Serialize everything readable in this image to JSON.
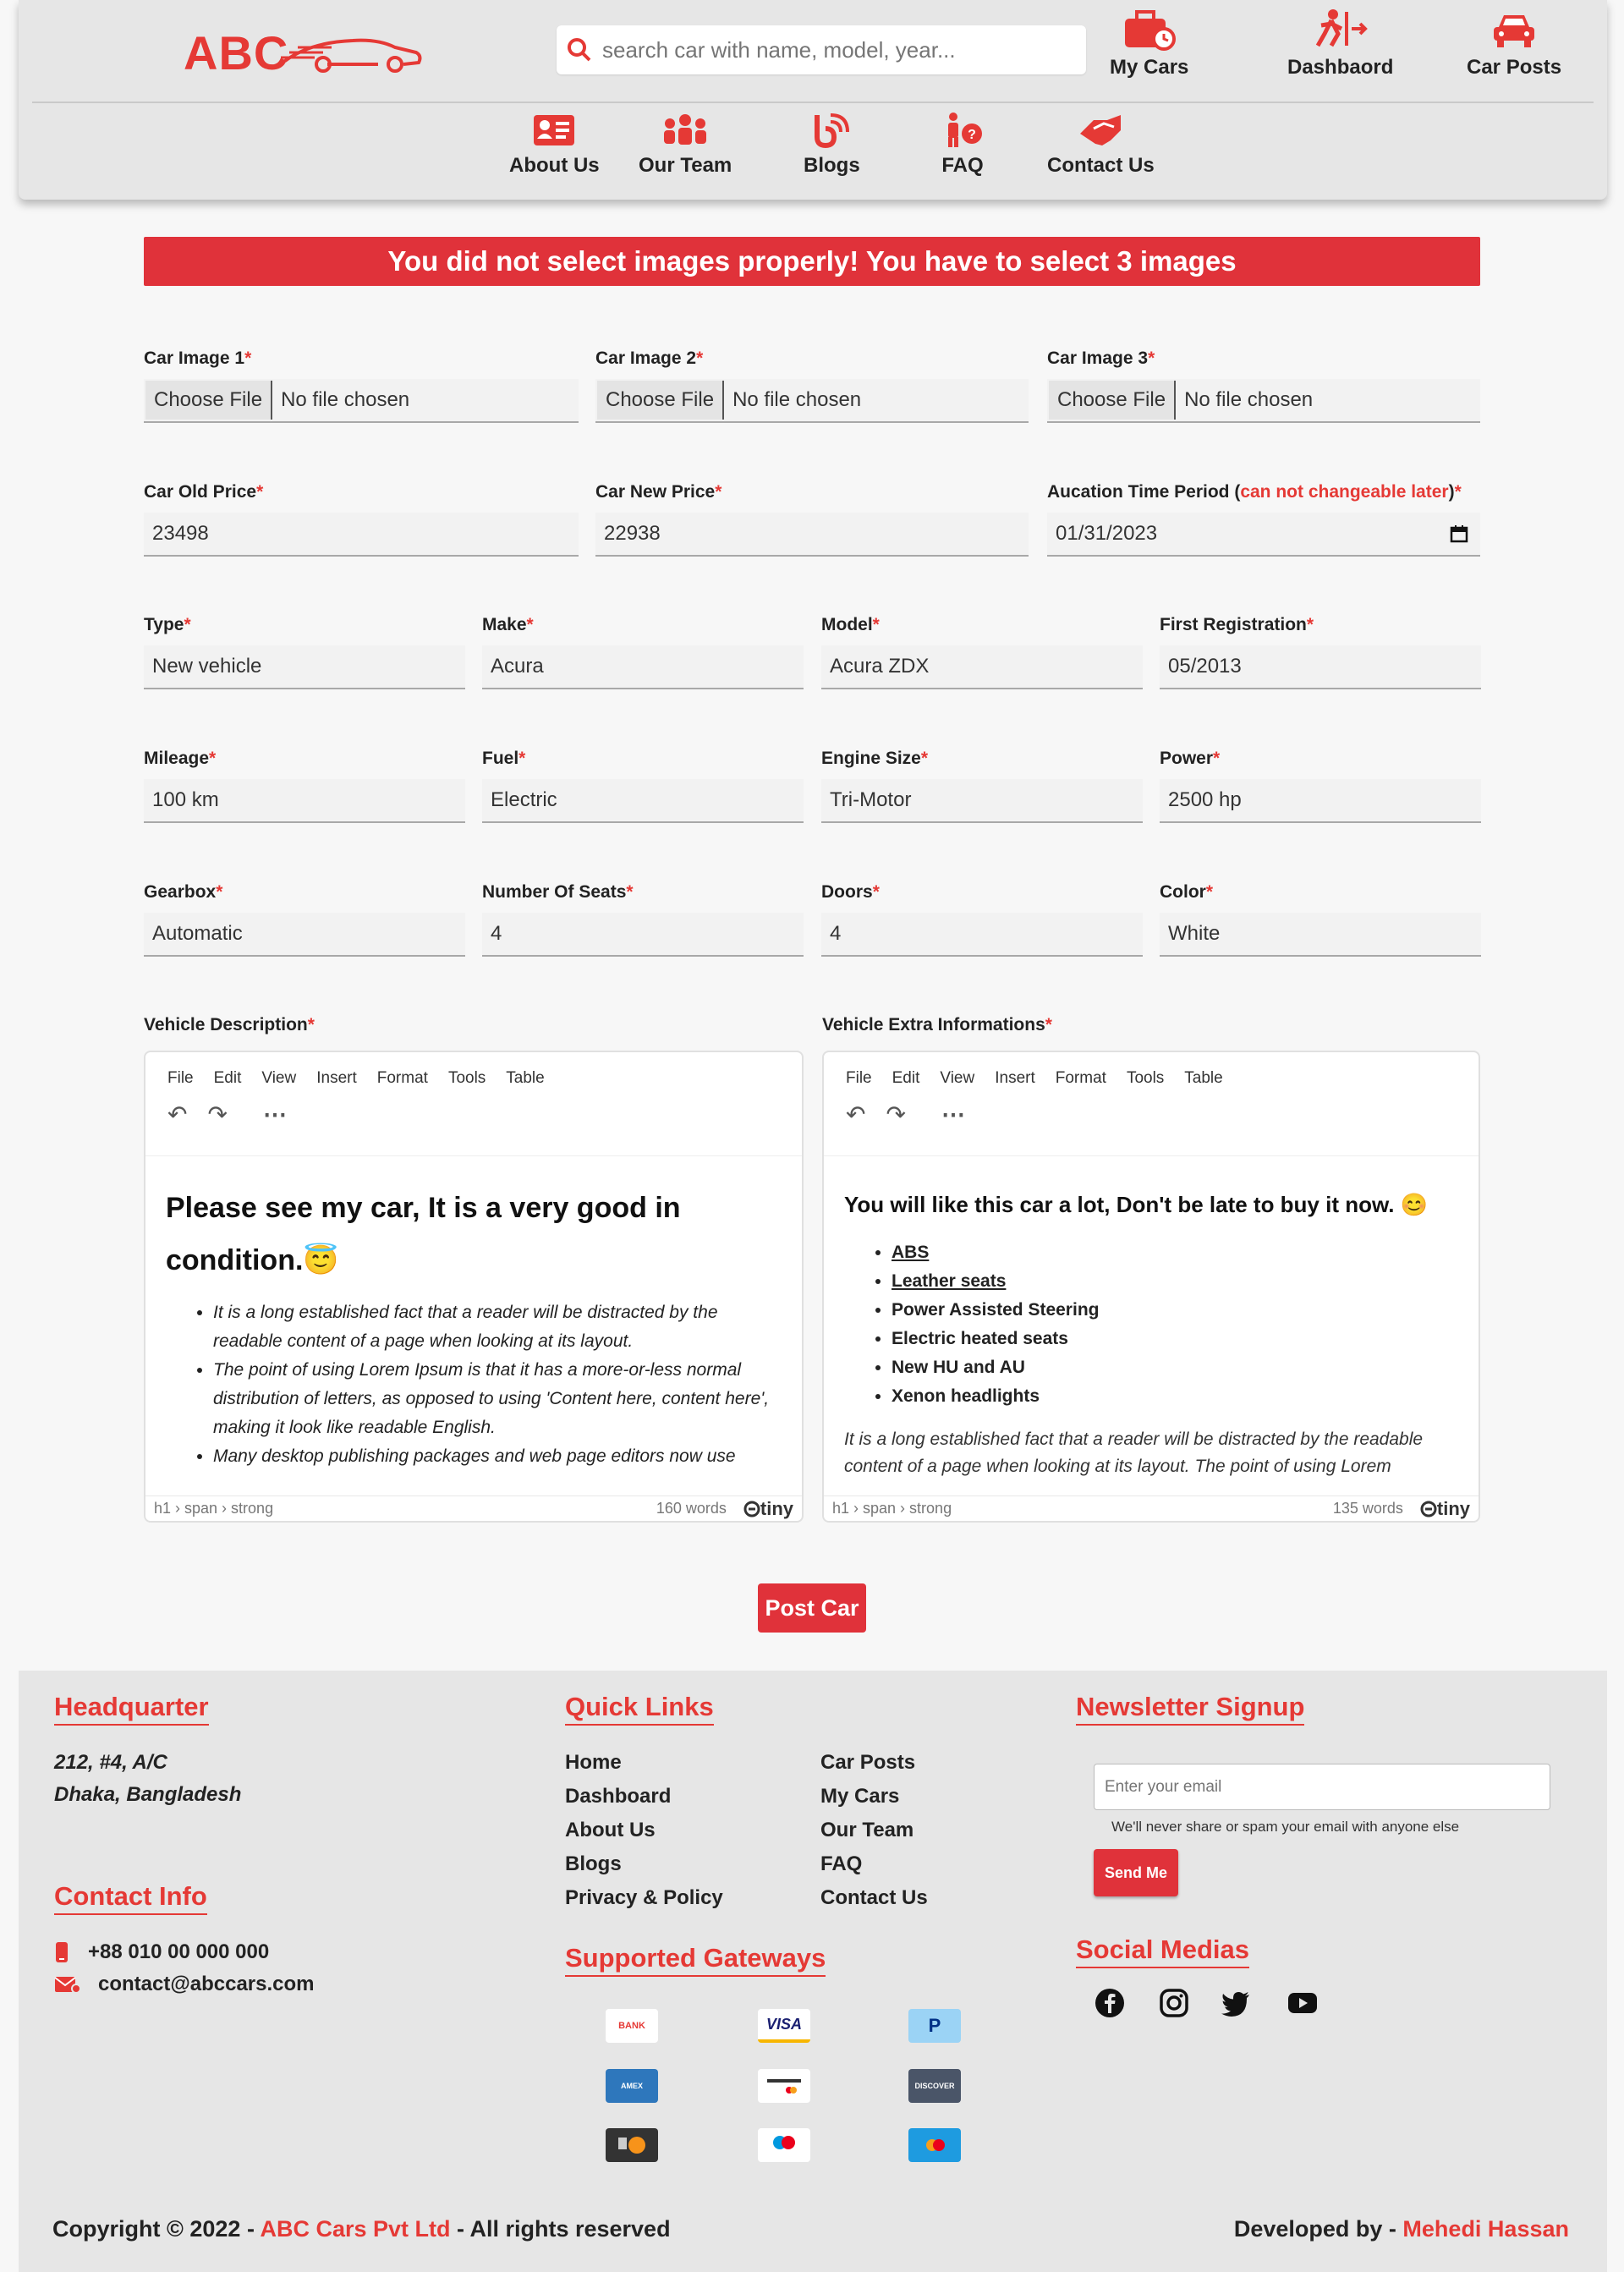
{
  "header": {
    "logo_text": "ABC",
    "search_placeholder": "search car with name, model, year...",
    "nav_top": [
      "My Cars",
      "Dashbaord",
      "Car Posts"
    ],
    "nav_bottom": [
      "About Us",
      "Our Team",
      "Blogs",
      "FAQ",
      "Contact Us"
    ]
  },
  "alert": "You did not select images properly! You have to select 3 images",
  "images": {
    "labels": [
      "Car Image 1",
      "Car Image 2",
      "Car Image 3"
    ],
    "button": "Choose File",
    "status": "No file chosen"
  },
  "prices": {
    "old_label": "Car Old Price",
    "old_value": "23498",
    "new_label": "Car New Price",
    "new_value": "22938",
    "auction_label": "Aucation Time Period (",
    "auction_note": "can not changeable later",
    "auction_label_end": ")",
    "auction_value": "01/31/2023"
  },
  "specs": [
    {
      "label": "Type",
      "value": "New vehicle"
    },
    {
      "label": "Make",
      "value": "Acura"
    },
    {
      "label": "Model",
      "value": "Acura ZDX"
    },
    {
      "label": "First Registration",
      "value": "05/2013"
    },
    {
      "label": "Mileage",
      "value": "100 km"
    },
    {
      "label": "Fuel",
      "value": "Electric"
    },
    {
      "label": "Engine Size",
      "value": "Tri-Motor"
    },
    {
      "label": "Power",
      "value": "2500 hp"
    },
    {
      "label": "Gearbox",
      "value": "Automatic"
    },
    {
      "label": "Number Of Seats",
      "value": "4"
    },
    {
      "label": "Doors",
      "value": "4"
    },
    {
      "label": "Color",
      "value": "White"
    }
  ],
  "editor_menu": [
    "File",
    "Edit",
    "View",
    "Insert",
    "Format",
    "Tools",
    "Table"
  ],
  "description": {
    "label": "Vehicle Description",
    "heading": "Please see my car, It is a very good in condition.",
    "emoji": "😇",
    "bullets": [
      "It is a long established fact that a reader will be distracted by the readable content of a page when looking at its layout.",
      "The point of using Lorem Ipsum is that it has a more-or-less normal distribution of letters, as opposed to using 'Content here, content here', making it look like readable English.",
      "Many desktop publishing packages and web page editors now use"
    ],
    "path": "h1 › span › strong",
    "words": "160 words"
  },
  "extra": {
    "label": "Vehicle Extra Informations",
    "heading": "You will like this car a lot, Don't be late to buy it now.",
    "emoji": "😊",
    "bullets": [
      "ABS",
      "Leather seats",
      "Power Assisted Steering",
      "Electric heated seats",
      "New HU and AU",
      "Xenon headlights"
    ],
    "paragraph": "It is a long established fact that a reader will be distracted by the readable content of a page when looking at its layout. The point of using Lorem",
    "path": "h1 › span › strong",
    "words": "135 words"
  },
  "tiny_label": "tiny",
  "post_button": "Post Car",
  "footer": {
    "hq_title": "Headquarter",
    "hq_line1": "212, #4, A/C",
    "hq_line2": "Dhaka, Bangladesh",
    "contact_title": "Contact Info",
    "phone": "+88 010 00 000 000",
    "email": "contact@abccars.com",
    "links_title": "Quick Links",
    "links_col1": [
      "Home",
      "Dashboard",
      "About Us",
      "Blogs",
      "Privacy & Policy"
    ],
    "links_col2": [
      "Car Posts",
      "My Cars",
      "Our Team",
      "FAQ",
      "Contact Us"
    ],
    "gateways_title": "Supported Gateways",
    "newsletter_title": "Newsletter Signup",
    "newsletter_placeholder": "Enter your email",
    "newsletter_note": "We'll never share or spam your email with anyone else",
    "newsletter_button": "Send Me",
    "social_title": "Social Medias",
    "copyright_pre": "Copyright © 2022 - ",
    "company": "ABC Cars Pvt Ltd",
    "copyright_post": " - All rights reserved",
    "dev_pre": "Developed by - ",
    "developer": "Mehedi Hassan"
  },
  "colors": {
    "accent": "#e53935",
    "alert_bg": "#e0323a",
    "header_bg": "#e6e6e6",
    "page_bg": "#f7f7f7"
  }
}
